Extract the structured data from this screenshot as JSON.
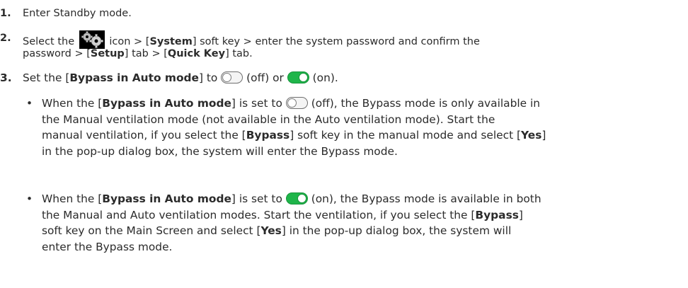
{
  "steps": [
    {
      "number": "1.",
      "text": "Enter Standby mode."
    },
    {
      "number": "2.",
      "line1_part1": "Select the",
      "line1_part2": "icon > [",
      "line1_bold1": "System",
      "line1_part3": "] soft key > enter the system password and confirm the",
      "line2_part1": "password > [",
      "line2_bold1": "Setup",
      "line2_part2": "] tab > [",
      "line2_bold2": "Quick Key",
      "line2_part3": "] tab."
    },
    {
      "number": "3.",
      "part1": "Set the [",
      "bold1": "Bypass in Auto mode",
      "part2": "] to",
      "part3": "(off) or",
      "part4": "(on)."
    }
  ],
  "bullets": [
    {
      "marker": "•",
      "l1_part1": "When the [",
      "l1_bold1": "Bypass in Auto mode",
      "l1_part2": "] is set to",
      "l1_part3": "(off), the Bypass mode is only available in",
      "l2": "the Manual ventilation mode (not available in the Auto ventilation mode). Start the",
      "l3_part1": "manual ventilation, if you select the [",
      "l3_bold1": "Bypass",
      "l3_part2": "] soft key in the manual mode and select [",
      "l3_bold2": "Yes",
      "l3_part3": "]",
      "l4": "in the pop-up dialog box, the system will enter the Bypass mode."
    },
    {
      "marker": "•",
      "l1_part1": "When the [",
      "l1_bold1": "Bypass in Auto mode",
      "l1_part2": "] is set to",
      "l1_part3": "(on), the Bypass mode is available in both",
      "l2_part1": "the Manual and Auto ventilation modes. Start the ventilation, if you select the [",
      "l2_bold1": "Bypass",
      "l2_part2": "]",
      "l3_part1": "soft key on the Main Screen and select [",
      "l3_bold1": "Yes",
      "l3_part2": "] in the pop-up dialog box, the system will",
      "l4": "enter the Bypass mode."
    }
  ],
  "icons": {
    "settings": "gears-icon",
    "toggle_off": "toggle-off-icon",
    "toggle_on": "toggle-on-icon"
  },
  "colors": {
    "text": "#2b2b2b",
    "toggle_on": "#1fb54a",
    "toggle_off_border": "#6f6f6f"
  }
}
